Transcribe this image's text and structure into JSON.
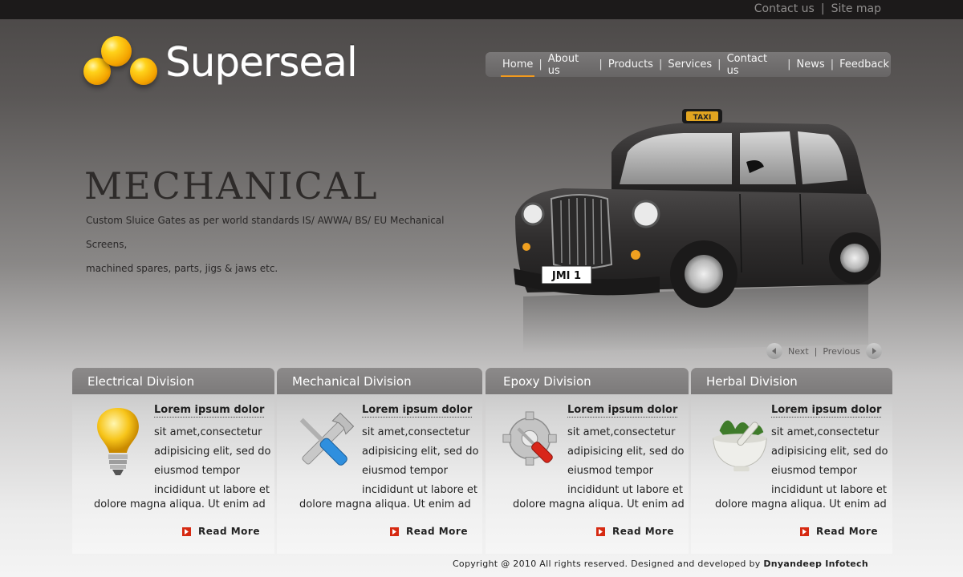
{
  "topbar": {
    "links": [
      "Contact us",
      "Site map"
    ],
    "separator": "|"
  },
  "brand": {
    "name": "Superseal"
  },
  "nav": {
    "items": [
      "Home",
      "About us",
      "Products",
      "Services",
      "Contact us",
      "News",
      "Feedback"
    ],
    "active": "Home",
    "separator": "|"
  },
  "hero": {
    "title": "MECHANICAL",
    "desc_line1": "Custom Sluice Gates as per world standards IS/ AWWA/ BS/ EU Mechanical Screens,",
    "desc_line2": "machined spares, parts, jigs & jaws etc.",
    "plate": "JMI 1",
    "taxi_sign": "TAXI",
    "next_label": "Next",
    "prev_label": "Previous",
    "ctrl_separator": "|"
  },
  "divisions": [
    {
      "title": "Electrical Division",
      "icon": "light-bulb-icon",
      "subtitle": "Lorem ipsum dolor",
      "text1": "sit amet,consectetur adipisicing elit, sed do eiusmod tempor incididunt ut labore et",
      "text2": "dolore magna aliqua. Ut enim ad",
      "read_more": "Read More"
    },
    {
      "title": "Mechanical Division",
      "icon": "wrench-screwdriver-icon",
      "subtitle": "Lorem ipsum dolor",
      "text1": "sit amet,consectetur adipisicing elit, sed do eiusmod tempor incididunt ut labore et",
      "text2": "dolore magna aliqua. Ut enim ad",
      "read_more": "Read More"
    },
    {
      "title": "Epoxy Division",
      "icon": "gear-screwdriver-icon",
      "subtitle": "Lorem ipsum dolor",
      "text1": "sit amet,consectetur adipisicing elit, sed do eiusmod tempor incididunt ut labore et",
      "text2": "dolore magna aliqua. Ut enim ad",
      "read_more": "Read More"
    },
    {
      "title": "Herbal Division",
      "icon": "mortar-pestle-icon",
      "subtitle": "Lorem ipsum dolor",
      "text1": "sit amet,consectetur adipisicing elit, sed do eiusmod tempor incididunt ut labore et",
      "text2": "dolore magna aliqua. Ut enim ad",
      "read_more": "Read More"
    }
  ],
  "footer": {
    "text": "Copyright @ 2010 All rights reserved. Designed and developed by",
    "company": "Dnyandeep Infotech"
  },
  "colors": {
    "accent": "#f29a1d",
    "arrow": "#d62a12",
    "card_head": "#858383",
    "topbar": "#1c1a1a"
  }
}
